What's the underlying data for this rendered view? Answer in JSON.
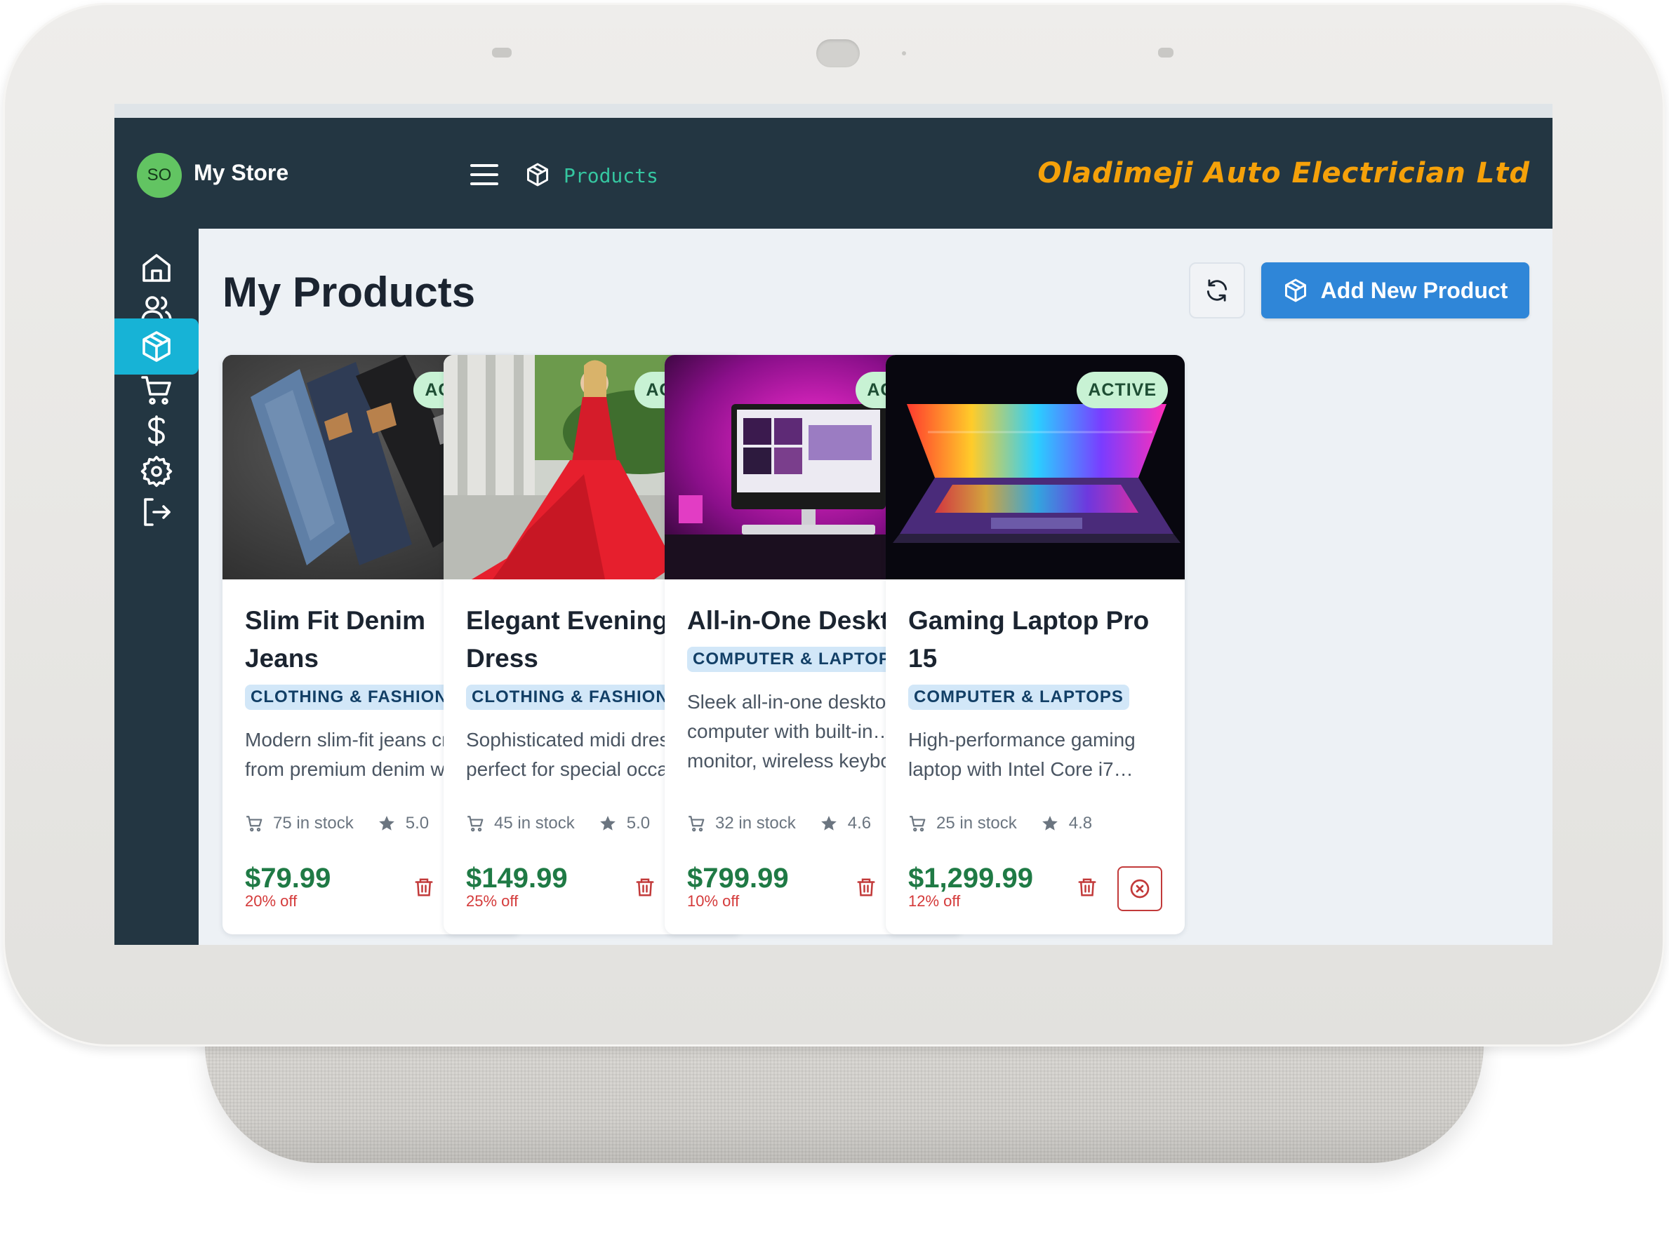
{
  "topbar": {
    "avatar_initials": "SO",
    "store_name": "My Store",
    "breadcrumb": "Products",
    "brand": "Oladimeji Auto Electrician Ltd"
  },
  "sidebar": {
    "items": [
      {
        "icon": "home-icon",
        "active": false
      },
      {
        "icon": "users-icon",
        "active": false
      },
      {
        "icon": "box-icon",
        "active": true
      },
      {
        "icon": "cart-icon",
        "active": false
      },
      {
        "icon": "dollar-icon",
        "active": false
      },
      {
        "icon": "gear-icon",
        "active": false
      },
      {
        "icon": "logout-icon",
        "active": false
      }
    ]
  },
  "main": {
    "title": "My Products",
    "refresh_icon": "refresh-icon",
    "add_button_label": "Add New Product"
  },
  "products": [
    {
      "badge": "ACTIVE",
      "title": "Slim Fit Denim Jeans",
      "category": "CLOTHING & FASHION",
      "description": "Modern slim-fit jeans crafted from premium denim with…",
      "stock": "75 in stock",
      "rating": "5.0",
      "price": "$79.99",
      "discount": "20% off"
    },
    {
      "badge": "ACTIVE",
      "title": "Elegant Evening Dress",
      "category": "CLOTHING & FASHION",
      "description": "Sophisticated midi dress perfect for special occasio…",
      "stock": "45 in stock",
      "rating": "5.0",
      "price": "$149.99",
      "discount": "25% off"
    },
    {
      "badge": "ACTIVE",
      "title": "All-in-One Desktop",
      "category": "COMPUTER & LAPTOPS",
      "description": "Sleek all-in-one desktop computer with built-in… monitor, wireless keyboard,",
      "stock": "32 in stock",
      "rating": "4.6",
      "price": "$799.99",
      "discount": "10% off"
    },
    {
      "badge": "ACTIVE",
      "title": "Gaming Laptop Pro 15",
      "category": "COMPUTER & LAPTOPS",
      "description": "High-performance gaming laptop with Intel Core i7…",
      "stock": "25 in stock",
      "rating": "4.8",
      "price": "$1,299.99",
      "discount": "12% off"
    }
  ],
  "colors": {
    "topbar": "#233642",
    "sidebar_active": "#17b3d6",
    "brand": "#f5a10a",
    "breadcrumb": "#35c6a0",
    "primary_button": "#2f86d8",
    "price": "#1f7a45",
    "discount": "#d43a3a",
    "badge_bg": "#c8f2d4",
    "category_bg": "#d2e7f8"
  }
}
